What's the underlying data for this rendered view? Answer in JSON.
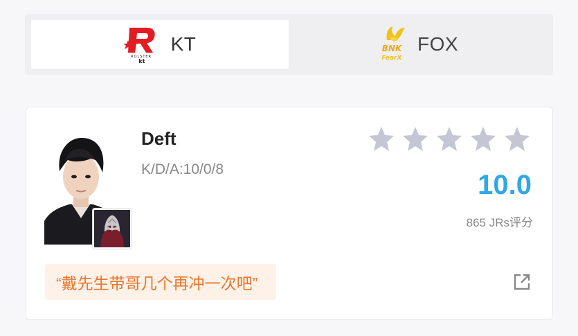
{
  "teams": [
    {
      "name": "KT",
      "logo_icon": "kt-rolster-logo",
      "active": true
    },
    {
      "name": "FOX",
      "logo_icon": "bnk-fearx-logo",
      "active": false
    }
  ],
  "player": {
    "name": "Deft",
    "kda": "K/D/A:10/0/8",
    "rating_stars": 0,
    "max_stars": 5,
    "score": "10.0",
    "rating_count": "865 JRs评分",
    "comment": "“戴先生带哥几个再冲一次吧”",
    "champion_icon": "champion-icon"
  },
  "colors": {
    "score_blue": "#2fa8e3",
    "comment_orange": "#e9772c",
    "comment_bg": "#fdf1e8",
    "star_gray": "#c4c6d3"
  }
}
